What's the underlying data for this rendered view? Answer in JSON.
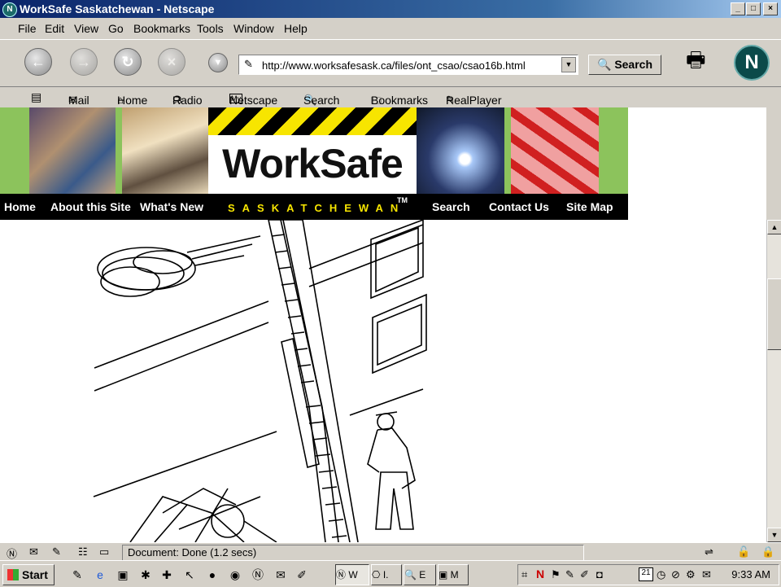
{
  "window": {
    "title": "WorkSafe Saskatchewan - Netscape",
    "min": "_",
    "max": "□",
    "close": "×"
  },
  "menu": [
    "File",
    "Edit",
    "View",
    "Go",
    "Bookmarks",
    "Tools",
    "Window",
    "Help"
  ],
  "toolbar": {
    "url": "http://www.worksafesask.ca/files/ont_csao/csao16b.html",
    "search_label": "Search"
  },
  "personal": {
    "mail": "Mail",
    "home": "Home",
    "radio": "Radio",
    "netscape": "Netscape",
    "search": "Search",
    "bookmarks": "Bookmarks",
    "realplayer": "RealPlayer"
  },
  "banner": {
    "logo": "WorkSafe",
    "region": "SASKATCHEWAN",
    "tm": "TM"
  },
  "sitenav": {
    "home": "Home",
    "about": "About this Site",
    "whatsnew": "What's New",
    "search": "Search",
    "contact": "Contact Us",
    "sitemap": "Site Map"
  },
  "status": {
    "text": "Document: Done (1.2 secs)"
  },
  "taskbar": {
    "start": "Start",
    "tasks": [
      "W",
      "I.",
      "E",
      "M"
    ],
    "clock": "9:33 AM",
    "date": "21"
  }
}
